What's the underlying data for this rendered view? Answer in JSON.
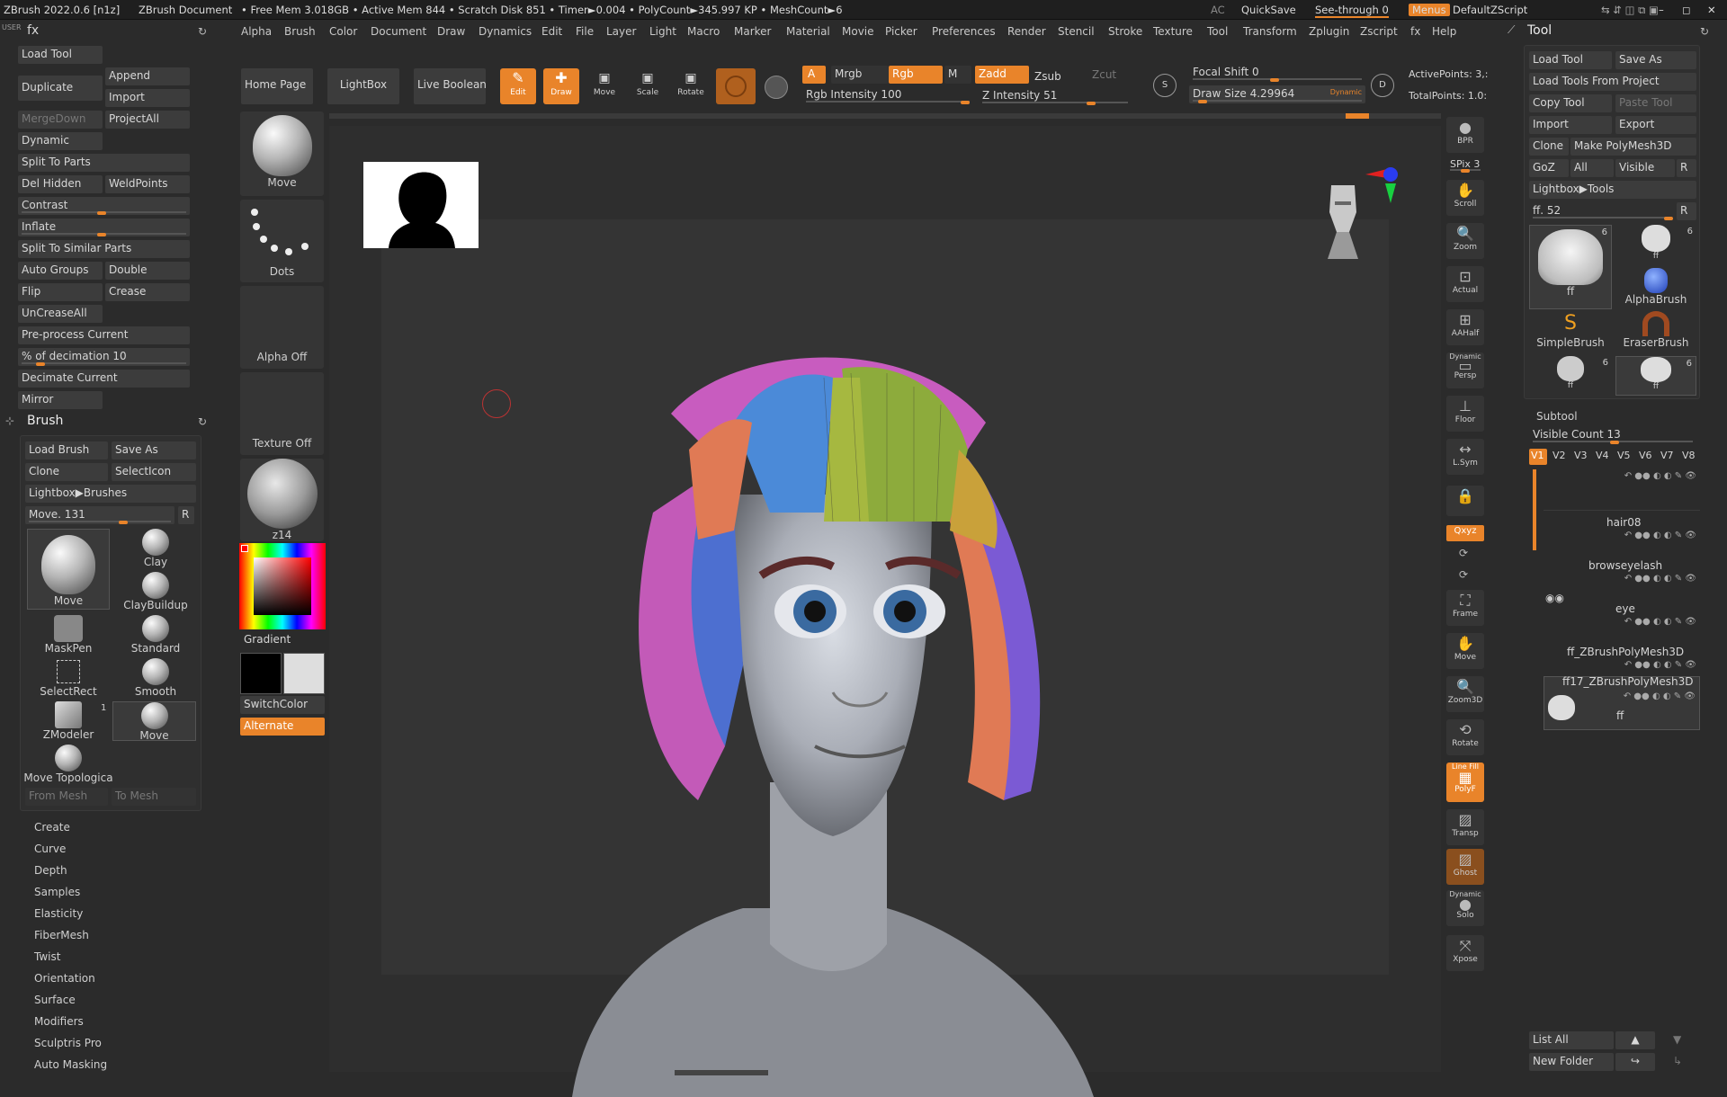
{
  "titlebar": {
    "app": "ZBrush 2022.0.6 [n1z]",
    "doc": "ZBrush Document",
    "stats": "• Free Mem 3.018GB • Active Mem 844 • Scratch Disk 851 • Timer►0.004 • PolyCount►345.997 KP • MeshCount►6",
    "ac": "AC",
    "quicksave": "QuickSave",
    "seethrough": "See-through 0",
    "menus": "Menus",
    "script": "DefaultZScript"
  },
  "menubar": [
    "Alpha",
    "Brush",
    "Color",
    "Document",
    "Draw",
    "Dynamics",
    "Edit",
    "File",
    "Layer",
    "Light",
    "Macro",
    "Marker",
    "Material",
    "Movie",
    "Picker",
    "Preferences",
    "Render",
    "Stencil",
    "Stroke",
    "Texture",
    "Tool",
    "Transform",
    "Zplugin",
    "Zscript",
    "fx",
    "Help"
  ],
  "left": {
    "user": "USER",
    "fx": "fx",
    "buttons": {
      "load_tool": "Load Tool",
      "duplicate": "Duplicate",
      "append": "Append",
      "import": "Import",
      "mergedown": "MergeDown",
      "projectall": "ProjectAll",
      "dynamic": "Dynamic",
      "split_parts": "Split To Parts",
      "del_hidden": "Del Hidden",
      "weldpoints": "WeldPoints",
      "contrast": "Contrast",
      "inflate": "Inflate",
      "split_similar": "Split To Similar Parts",
      "auto_groups": "Auto Groups",
      "double": "Double",
      "flip": "Flip",
      "crease": "Crease",
      "uncreaseall": "UnCreaseAll",
      "preprocess": "Pre-process Current",
      "decimation": "% of decimation 10",
      "decimate": "Decimate Current",
      "mirror": "Mirror"
    },
    "brush": {
      "title": "Brush",
      "load": "Load Brush",
      "save": "Save As",
      "clone": "Clone",
      "selecticon": "SelectIcon",
      "lightbox": "Lightbox▶Brushes",
      "slider": "Move. 131",
      "r": "R",
      "tiles": [
        "Move",
        "Clay",
        "ClayBuildup",
        "MaskPen",
        "Standard",
        "SelectRect",
        "Smooth",
        "ZModeler",
        "Move",
        "Move Topologica"
      ],
      "zmodeler_count": "1",
      "from_mesh": "From Mesh",
      "to_mesh": "To Mesh"
    },
    "subpalettes": [
      "Create",
      "Curve",
      "Depth",
      "Samples",
      "Elasticity",
      "FiberMesh",
      "Twist",
      "Orientation",
      "Surface",
      "Modifiers",
      "Sculptris Pro",
      "Auto Masking"
    ]
  },
  "shelf": {
    "move": "Move",
    "dots": "Dots",
    "alpha": "Alpha Off",
    "texture": "Texture Off",
    "material": "z14",
    "gradient": "Gradient",
    "switchcolor": "SwitchColor",
    "alternate": "Alternate"
  },
  "topbar": {
    "home": "Home Page",
    "lightbox": "LightBox",
    "liveboolean": "Live Boolean",
    "edit": "Edit",
    "draw": "Draw",
    "move": "Move",
    "scale": "Scale",
    "rotate": "Rotate",
    "a": "A",
    "mrgb": "Mrgb",
    "rgb": "Rgb",
    "m": "M",
    "zadd": "Zadd",
    "zsub": "Zsub",
    "zcut": "Zcut",
    "rgb_intensity": "Rgb Intensity 100",
    "z_intensity": "Z Intensity 51",
    "focal": "Focal Shift 0",
    "drawsize": "Draw Size 4.29964",
    "dynamic": "Dynamic",
    "activepoints": "ActivePoints: 3,:",
    "totalpoints": "TotalPoints: 1.0:"
  },
  "righttools": {
    "bpr": "BPR",
    "spix": "SPix 3",
    "items": [
      "Scroll",
      "Zoom",
      "Actual",
      "AAHalf",
      "Persp",
      "Floor",
      "L.Sym",
      "",
      "Frame",
      "Move",
      "Zoom3D",
      "Rotate",
      "PolyF",
      "Transp",
      "Ghost",
      "Solo",
      "Xpose"
    ],
    "xyz": "Qxyz",
    "dynamic": "Dynamic",
    "linefill": "Line Fill"
  },
  "tool": {
    "title": "Tool",
    "load": "Load Tool",
    "save": "Save As",
    "load_project": "Load Tools From Project",
    "copy": "Copy Tool",
    "paste": "Paste Tool",
    "import": "Import",
    "export": "Export",
    "clone": "Clone",
    "make": "Make PolyMesh3D",
    "goz": "GoZ",
    "all": "All",
    "visible": "Visible",
    "r": "R",
    "lightbox": "Lightbox▶Tools",
    "slider": "ff. 52",
    "thumbs": [
      {
        "label": "ff",
        "count": "6"
      },
      {
        "label": "ff",
        "count": "6"
      },
      {
        "label": "AlphaBrush",
        "count": ""
      },
      {
        "label": "SimpleBrush",
        "count": ""
      },
      {
        "label": "EraserBrush",
        "count": ""
      },
      {
        "label": "ff",
        "count": "6"
      },
      {
        "label": "ff",
        "count": "6"
      }
    ]
  },
  "subtool": {
    "title": "Subtool",
    "visible_count": "Visible Count 13",
    "versions": [
      "V1",
      "V2",
      "V3",
      "V4",
      "V5",
      "V6",
      "V7",
      "V8"
    ],
    "items": [
      "hair08",
      "browseyelash",
      "eye",
      "ff_ZBrushPolyMesh3D",
      "ff17_ZBrushPolyMesh3D",
      "ff"
    ],
    "list_all": "List All",
    "new_folder": "New Folder"
  }
}
